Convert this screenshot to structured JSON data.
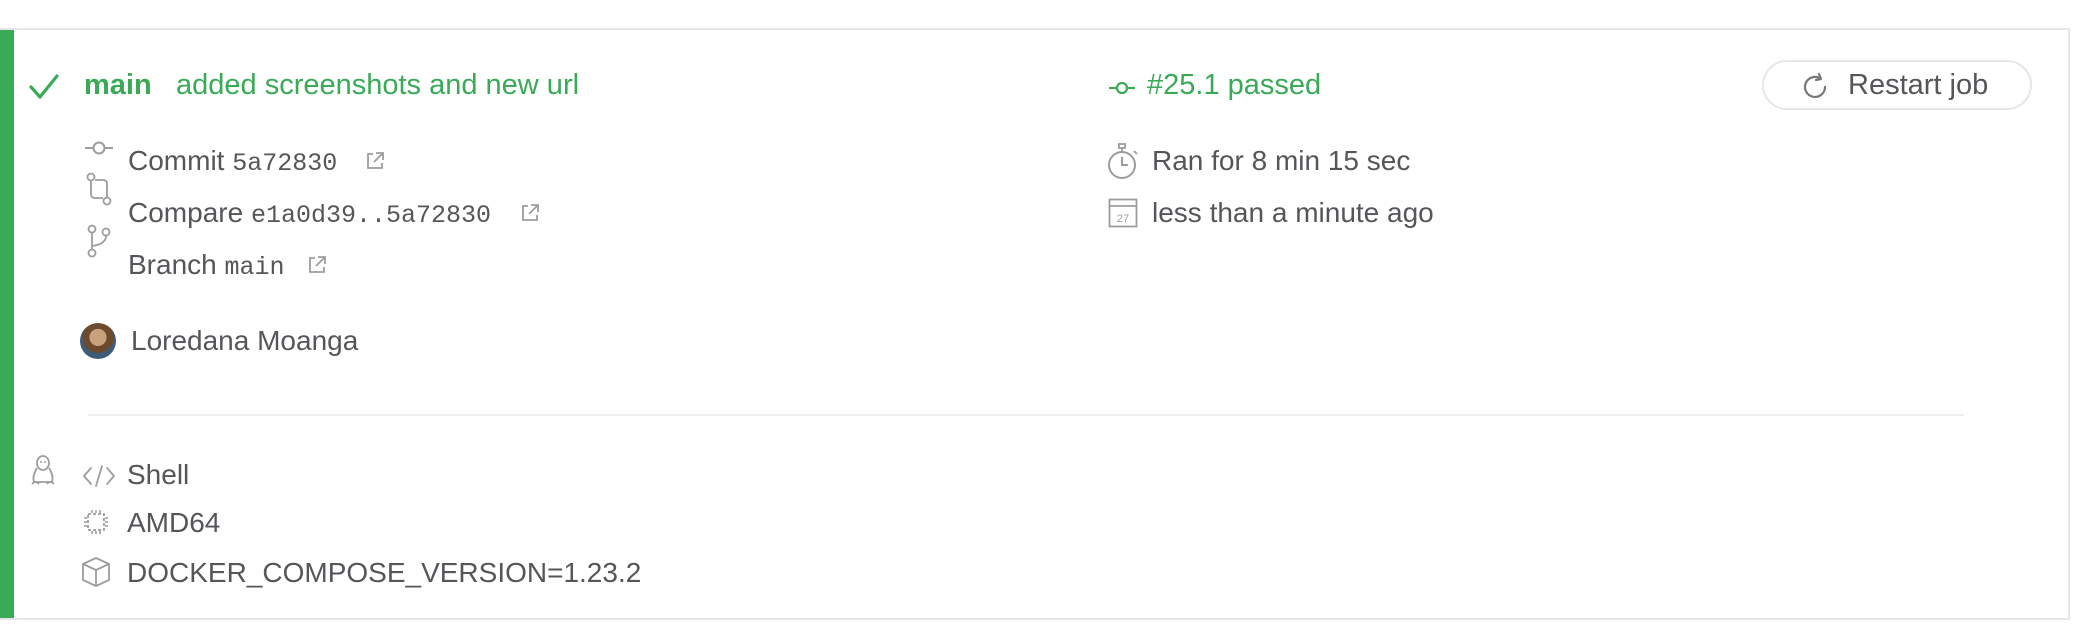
{
  "header": {
    "branch": "main",
    "commit_message": "added screenshots and new url",
    "build_status": "#25.1 passed",
    "restart_label": "Restart job"
  },
  "details": {
    "commit_label": "Commit",
    "commit_sha": "5a72830",
    "compare_label": "Compare",
    "compare_range": "e1a0d39..5a72830",
    "branch_label": "Branch",
    "branch_name": "main",
    "author": "Loredana Moanga",
    "duration": "Ran for 8 min 15 sec",
    "finished": "less than a minute ago",
    "calendar_day": "27"
  },
  "config": {
    "language": "Shell",
    "arch": "AMD64",
    "env": "DOCKER_COMPOSE_VERSION=1.23.2"
  },
  "colors": {
    "passed": "#39aa56",
    "text": "#555659",
    "icon": "#9d9d9d",
    "border": "#e6e6e6"
  },
  "icons": {
    "status": "check-icon",
    "commit": "commit-icon",
    "compare": "compare-icon",
    "branch": "branch-icon",
    "external": "external-link-icon",
    "timer": "stopwatch-icon",
    "calendar": "calendar-icon",
    "restart": "restart-icon",
    "os": "linux-tux-icon",
    "language": "code-icon",
    "arch": "cpu-icon",
    "env": "package-icon"
  }
}
